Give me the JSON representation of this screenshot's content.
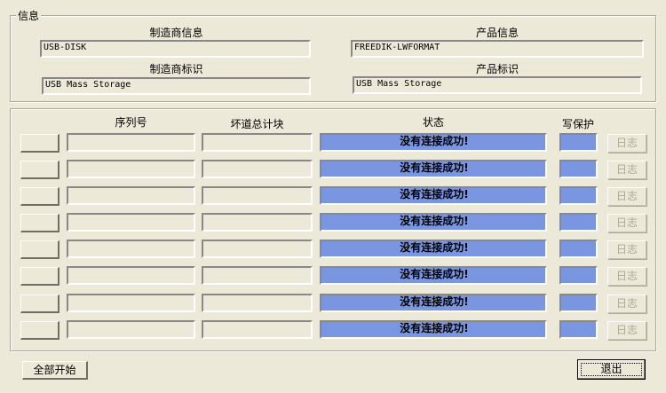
{
  "info": {
    "title": "信息",
    "manufacturer_info_label": "制造商信息",
    "manufacturer_info": "USB-DISK",
    "manufacturer_id_label": "制造商标识",
    "manufacturer_id": "USB Mass Storage",
    "product_info_label": "产品信息",
    "product_info": "FREEDIK-LWFORMAT",
    "product_id_label": "产品标识",
    "product_id": "USB Mass Storage"
  },
  "table": {
    "headers": {
      "serial": "序列号",
      "bad_blocks": "坏道总计块",
      "status": "状态",
      "write_protect": "写保护"
    },
    "rows": [
      {
        "serial": "",
        "bad_blocks": "",
        "status": "没有连接成功!",
        "write_protect": "",
        "log": "日志"
      },
      {
        "serial": "",
        "bad_blocks": "",
        "status": "没有连接成功!",
        "write_protect": "",
        "log": "日志"
      },
      {
        "serial": "",
        "bad_blocks": "",
        "status": "没有连接成功!",
        "write_protect": "",
        "log": "日志"
      },
      {
        "serial": "",
        "bad_blocks": "",
        "status": "没有连接成功!",
        "write_protect": "",
        "log": "日志"
      },
      {
        "serial": "",
        "bad_blocks": "",
        "status": "没有连接成功!",
        "write_protect": "",
        "log": "日志"
      },
      {
        "serial": "",
        "bad_blocks": "",
        "status": "没有连接成功!",
        "write_protect": "",
        "log": "日志"
      },
      {
        "serial": "",
        "bad_blocks": "",
        "status": "没有连接成功!",
        "write_protect": "",
        "log": "日志"
      },
      {
        "serial": "",
        "bad_blocks": "",
        "status": "没有连接成功!",
        "write_protect": "",
        "log": "日志"
      }
    ]
  },
  "buttons": {
    "start_all": "全部开始",
    "exit": "退出"
  },
  "colors": {
    "status_bg": "#7b96e0",
    "window_bg": "#ece9d8"
  }
}
